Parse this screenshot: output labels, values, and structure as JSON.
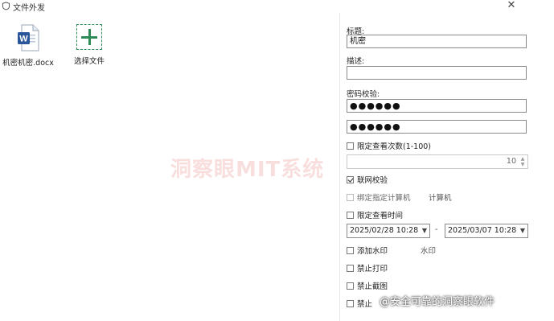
{
  "window": {
    "title": "文件外发",
    "close_glyph": "✕",
    "icon": "shield-icon"
  },
  "files": {
    "items": [
      {
        "name": "机密机密.docx",
        "icon": "word-document-icon"
      },
      {
        "name": "选择文件",
        "icon": "add-file-icon"
      }
    ]
  },
  "form": {
    "title_label": "标题:",
    "title_value": "机密",
    "desc_label": "描述:",
    "desc_value": "",
    "password_label": "密码校验:",
    "password_value": "●●●●●●",
    "password_confirm_value": "●●●●●●",
    "limit_views_label": "限定查看次数(1-100)",
    "limit_views_checked": false,
    "limit_views_value": "10",
    "network_check_label": "联网校验",
    "network_check_checked": true,
    "bind_computer_label": "绑定指定计算机",
    "bind_computer_checked": false,
    "bind_computer_side_label": "计算机",
    "limit_time_label": "限定查看时间",
    "limit_time_checked": false,
    "start_time": "2025/02/28 10:28",
    "end_time": "2025/03/07 10:28",
    "time_separator": "-",
    "watermark_label": "添加水印",
    "watermark_checked": false,
    "watermark_side_label": "水印",
    "no_print_label": "禁止打印",
    "no_print_checked": false,
    "no_screenshot_label": "禁止截图",
    "no_screenshot_checked": false,
    "last_option_label": "禁止"
  },
  "overlay": {
    "watermark_text": "洞察眼MIT系统",
    "credit_text": "@安全可靠的洞察眼软件"
  },
  "colors": {
    "add_accent": "#2e8b57",
    "word_blue": "#2b579a",
    "watermark_red": "#dc4646"
  }
}
